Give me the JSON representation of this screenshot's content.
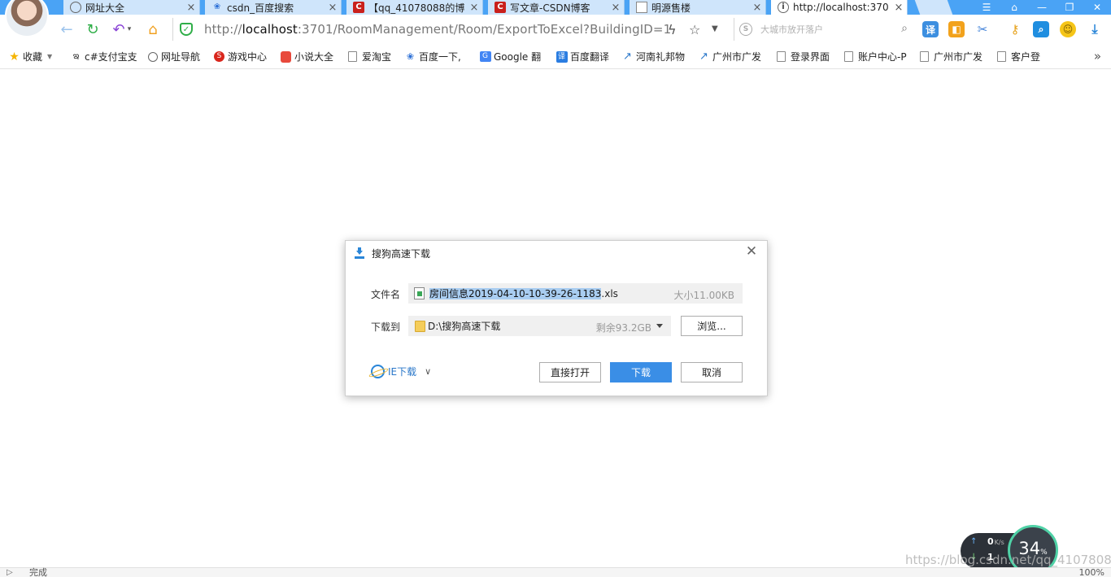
{
  "browser": {
    "tabs": [
      {
        "icon": "globe-icon",
        "title": "网址大全",
        "active": false
      },
      {
        "icon": "baidu-paw-icon",
        "title": "csdn_百度搜索",
        "active": false
      },
      {
        "icon": "csdn-icon",
        "title": "【qq_41078088的博",
        "active": false
      },
      {
        "icon": "csdn-icon",
        "title": "写文章-CSDN博客",
        "active": false
      },
      {
        "icon": "page-icon",
        "title": "明源售楼",
        "active": false
      },
      {
        "icon": "info-icon",
        "title": "http://localhost:370",
        "active": true
      }
    ],
    "close_glyph": "×",
    "address": {
      "scheme": "http://",
      "host": "localhost",
      "rest": ":3701/RoomManagement/Room/ExportToExcel?BuildingID=1"
    },
    "search": {
      "placeholder": "大城市放开落户"
    },
    "bookmarks": [
      {
        "icon": "star-icon",
        "label": "收藏"
      },
      {
        "icon": "alipay-icon",
        "label": "c#支付宝支"
      },
      {
        "icon": "globe-icon",
        "label": "网址导航"
      },
      {
        "icon": "game-icon",
        "label": "游戏中心"
      },
      {
        "icon": "novel-icon",
        "label": "小说大全"
      },
      {
        "icon": "page-icon",
        "label": "爱淘宝"
      },
      {
        "icon": "baidu-paw-icon",
        "label": "百度一下,"
      },
      {
        "icon": "google-translate-icon",
        "label": "Google 翻"
      },
      {
        "icon": "baidu-translate-icon",
        "label": "百度翻译"
      },
      {
        "icon": "chart-icon",
        "label": "河南礼邦物"
      },
      {
        "icon": "chart-icon",
        "label": "广州市广发"
      },
      {
        "icon": "page-icon",
        "label": "登录界面"
      },
      {
        "icon": "page-icon",
        "label": "账户中心-P"
      },
      {
        "icon": "page-icon",
        "label": "广州市广发"
      },
      {
        "icon": "page-icon",
        "label": "客户登"
      }
    ],
    "more_glyph": "»"
  },
  "dialog": {
    "title": "搜狗高速下载",
    "filename_label": "文件名",
    "filename_selected": "房间信息2019-04-10-10-39-26-1183",
    "filename_ext": ".xls",
    "filesize": "大小11.00KB",
    "saveto_label": "下载到",
    "saveto_path": "D:\\搜狗高速下载",
    "free_space": "剩余93.2GB",
    "browse_label": "浏览...",
    "ie_download_label": "IE下载",
    "open_label": "直接打开",
    "download_label": "下载",
    "cancel_label": "取消"
  },
  "status": {
    "text": "完成",
    "zoom": "100%"
  },
  "netspeed": {
    "up": "0",
    "up_unit": "K/s",
    "down": "1",
    "cpu": "34"
  },
  "watermark": "https://blog.csdn.net/qq_41078088",
  "colors": {
    "tab_strip": "#4aa3f5",
    "primary_button": "#3a8ee6",
    "selection": "#a9cdf1",
    "secure_shield": "#2fae48"
  }
}
